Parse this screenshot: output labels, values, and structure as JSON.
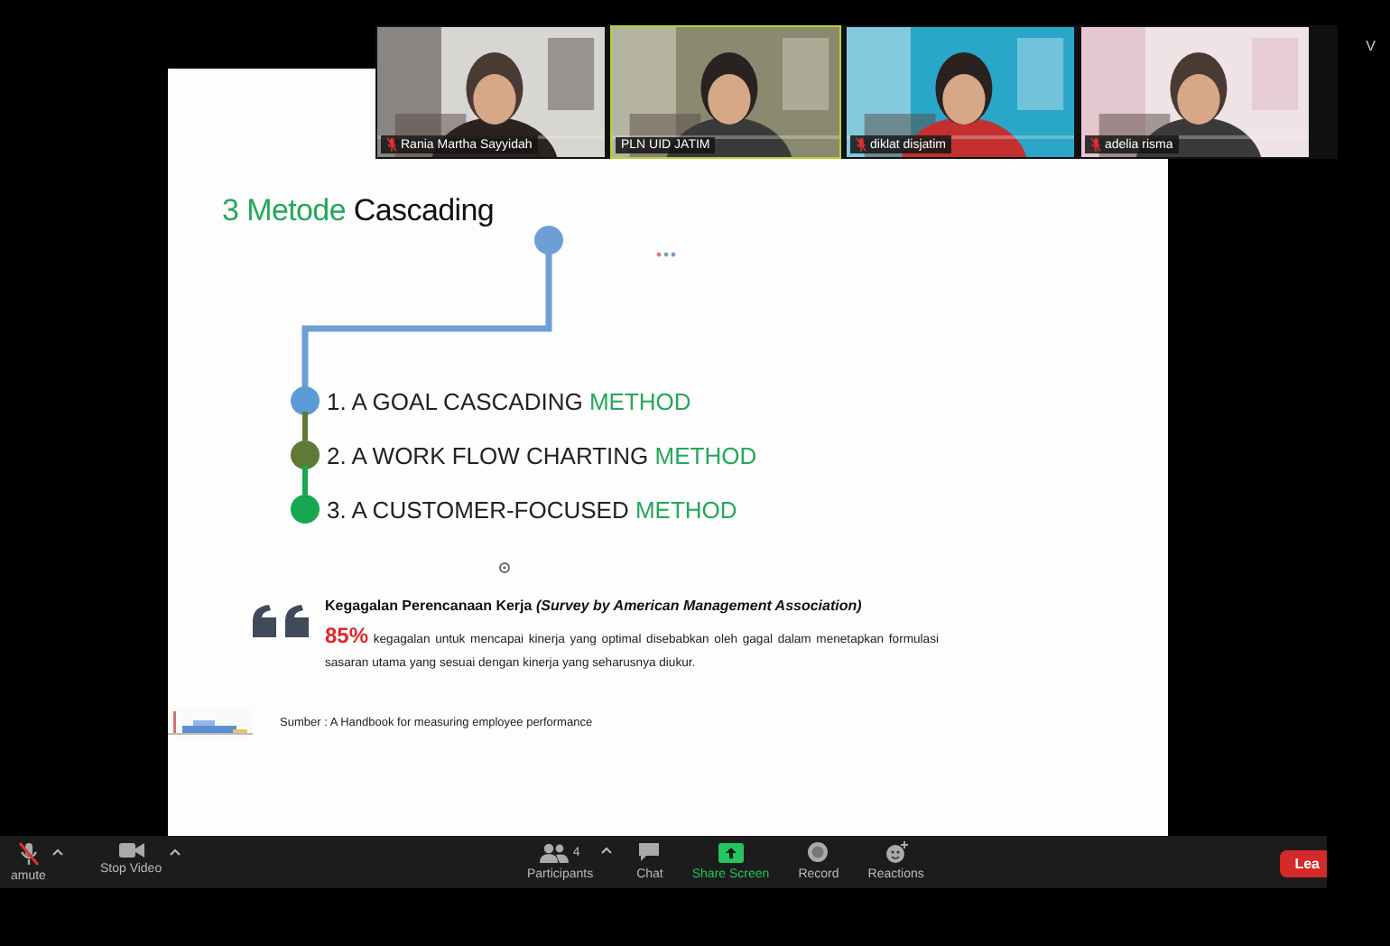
{
  "slide": {
    "title_highlight": "3 Metode",
    "title_rest": "Cascading",
    "methods": [
      {
        "text": "1. A GOAL CASCADING",
        "highlight": "METHOD",
        "color": "#5b9bd5"
      },
      {
        "text": "2. A WORK FLOW CHARTING",
        "highlight": "METHOD",
        "color": "#5e7a36"
      },
      {
        "text": "3. A CUSTOMER-FOCUSED",
        "highlight": "METHOD",
        "color": "#17a84f"
      }
    ],
    "quote": {
      "heading": "Kegagalan Perencanaan Kerja *(Survey by American Management Association)*",
      "stat": "85%",
      "body": "kegagalan untuk mencapai kinerja yang optimal disebabkan oleh gagal dalam menetapkan formulasi sasaran utama yang sesuai dengan kinerja yang seharusnya diukur."
    },
    "source": "Sumber : A Handbook for measuring employee performance"
  },
  "participants": [
    {
      "name": "Rania Martha Sayyidah",
      "muted": true,
      "speaking": false
    },
    {
      "name": "PLN UID JATIM",
      "muted": false,
      "speaking": true
    },
    {
      "name": "diklat disjatim",
      "muted": true,
      "speaking": false
    },
    {
      "name": "adelia risma",
      "muted": true,
      "speaking": false
    }
  ],
  "corner_label": "V",
  "toolbar": [
    {
      "kind": "mic",
      "label": "amute",
      "muted": true,
      "caret": true
    },
    {
      "kind": "video",
      "label": "Stop Video",
      "caret": true
    },
    {
      "kind": "participants",
      "label": "Participants",
      "count": "4",
      "caret": true
    },
    {
      "kind": "chat",
      "label": "Chat",
      "caret": false
    },
    {
      "kind": "share",
      "label": "Share Screen",
      "caret": false
    },
    {
      "kind": "record",
      "label": "Record",
      "caret": false
    },
    {
      "kind": "reactions",
      "label": "Reactions",
      "caret": false
    }
  ],
  "leave": {
    "label": "Lea"
  }
}
